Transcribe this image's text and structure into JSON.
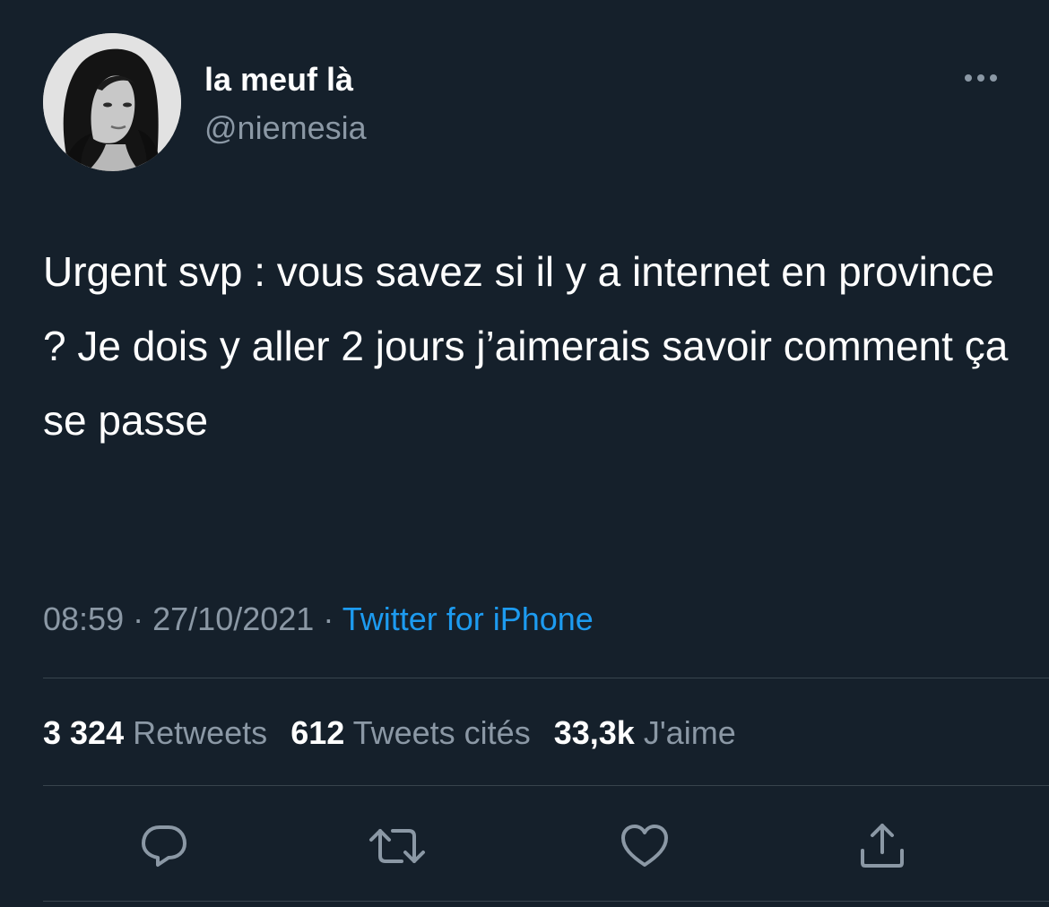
{
  "author": {
    "display_name": "la meuf là",
    "handle": "@niemesia",
    "avatar_icon": "profile-photo"
  },
  "menu": {
    "icon": "more-horizontal-icon"
  },
  "tweet": {
    "text": "Urgent svp : vous savez si il y a internet en province ? Je dois y aller 2 jours j’aimerais savoir comment ça se passe",
    "time": "08:59",
    "separator": "·",
    "date": "27/10/2021",
    "source": "Twitter for iPhone"
  },
  "stats": {
    "retweets_count": "3 324",
    "retweets_label": "Retweets",
    "quotes_count": "612",
    "quotes_label": "Tweets cités",
    "likes_count": "33,3k",
    "likes_label": "J'aime"
  },
  "actions": [
    {
      "name": "reply",
      "icon": "reply-icon"
    },
    {
      "name": "retweet",
      "icon": "retweet-icon"
    },
    {
      "name": "like",
      "icon": "heart-icon"
    },
    {
      "name": "share",
      "icon": "share-icon"
    }
  ],
  "colors": {
    "background": "#15202b",
    "primary_text": "#ffffff",
    "secondary_text": "#8b98a5",
    "link": "#1d9bf0",
    "divider": "#38444d"
  }
}
